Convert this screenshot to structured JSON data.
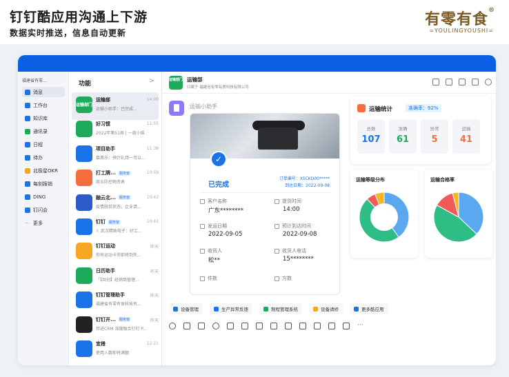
{
  "header": {
    "title": "钉钉酷应用沟通上下游",
    "subtitle": "数据实时推送，信息自动更新"
  },
  "brand": {
    "cn": "有零有食",
    "reg": "®",
    "en": "=YOULINGYOUSHI="
  },
  "sidebar": {
    "org": "福建省有零...",
    "items": [
      {
        "label": "消息"
      },
      {
        "label": "工作台"
      },
      {
        "label": "知识库"
      },
      {
        "label": "通讯录"
      },
      {
        "label": "日程"
      },
      {
        "label": "待办"
      },
      {
        "label": "北极星OKR"
      },
      {
        "label": "每刻报销"
      },
      {
        "label": "DING"
      },
      {
        "label": "钉闪会"
      },
      {
        "label": "更多"
      }
    ]
  },
  "list": {
    "title": "功能",
    "chevron": ">",
    "items": [
      {
        "name": "运输部",
        "preview": "运输小助手：已完成...",
        "time": "14:00",
        "avatar": "运输部门",
        "color": "#1eaa5b",
        "tag": ""
      },
      {
        "name": "好习惯",
        "preview": "2022年第51周 | 一周小结",
        "time": "11:55",
        "avatar": "",
        "color": "#1eaa5b",
        "tag": ""
      },
      {
        "name": "项目助手",
        "preview": "慕燕乐：预计礼拜一可以...",
        "time": "11:38",
        "avatar": "",
        "color": "#1a73e8",
        "tag": ""
      },
      {
        "name": "打工牌...",
        "preview": "周五防控物资表",
        "time": "10:59",
        "avatar": "",
        "color": "#f56c3d",
        "tag": "服务窗"
      },
      {
        "name": "融云北...",
        "preview": "疫情脱贫状态，企业请...",
        "time": "10:43",
        "avatar": "",
        "color": "#2b5bc8",
        "tag": "服务窗"
      },
      {
        "name": "钉钉",
        "preview": "✌ 武汉精致电子：好工...",
        "time": "10:43",
        "avatar": "",
        "color": "#1a73e8",
        "tag": "服务窗"
      },
      {
        "name": "钉钉运动",
        "preview": "你有运动卡市即将到失...",
        "time": "昨天",
        "avatar": "",
        "color": "#f5a623",
        "tag": ""
      },
      {
        "name": "日历助手",
        "preview": "「【共创】经销商管理...",
        "time": "昨天",
        "avatar": "",
        "color": "#1eaa5b",
        "tag": ""
      },
      {
        "name": "钉钉管理助手",
        "preview": "福建省有零有食科技有...",
        "time": "昨天",
        "avatar": "",
        "color": "#1a73e8",
        "tag": ""
      },
      {
        "name": "钉钉开...",
        "preview": "邦迹CRM 深度融合钉钉 P...",
        "time": "昨天",
        "avatar": "",
        "color": "#222",
        "tag": "服务窗"
      },
      {
        "name": "宜搭",
        "preview": "使用人数即将满额",
        "time": "12-21",
        "avatar": "",
        "color": "#1a73e8",
        "tag": ""
      }
    ]
  },
  "chat": {
    "name": "运输部",
    "org": "归属于 福建省有零有食科技有限公司",
    "avatar": "运输部门",
    "bot": "运输小助手"
  },
  "card": {
    "status": "已完成",
    "order_no": "订单编号：XSCKD00*****",
    "arrival": "到达日期：2022-09-08",
    "fields": [
      {
        "label": "客户名称",
        "value": "广东********"
      },
      {
        "label": "提货时间",
        "value": "14:00"
      },
      {
        "label": "发运日期",
        "value": "2022-09-05"
      },
      {
        "label": "预计到达时间",
        "value": "2022-09-08"
      },
      {
        "label": "收货人",
        "value": "松**"
      },
      {
        "label": "收货人电话",
        "value": "15********"
      },
      {
        "label": "件数",
        "value": ""
      },
      {
        "label": "方数",
        "value": ""
      }
    ]
  },
  "stats": {
    "title": "运输统计",
    "rate": "准确率：92%",
    "boxes": [
      {
        "label": "总数",
        "value": "107",
        "color": "#1a73e8"
      },
      {
        "label": "准确",
        "value": "61",
        "color": "#1eaa5b"
      },
      {
        "label": "异常",
        "value": "5",
        "color": "#f56c3d"
      },
      {
        "label": "运输",
        "value": "41",
        "color": "#f56c3d"
      }
    ]
  },
  "charts": [
    {
      "title": "运输等级分布",
      "type": "donut",
      "segments": [
        {
          "value": 0.4,
          "color": "#5aa9f0"
        },
        {
          "value": 0.48,
          "color": "#2ebd85"
        },
        {
          "value": 0.06,
          "color": "#f25a5a"
        },
        {
          "value": 0.06,
          "color": "#f5b623"
        }
      ]
    },
    {
      "title": "运输合格率",
      "type": "pie",
      "segments": [
        {
          "value": 0.37,
          "color": "#5aa9f0"
        },
        {
          "value": 0.46,
          "color": "#2ebd85"
        },
        {
          "value": 0.13,
          "color": "#f25a5a"
        },
        {
          "value": 0.04,
          "color": "#f5b623"
        }
      ]
    }
  ],
  "shortcuts": [
    {
      "label": "设备管理",
      "color": "#1a73e8"
    },
    {
      "label": "生产异常反馈",
      "color": "#1a73e8"
    },
    {
      "label": "制程管理系统",
      "color": "#1eaa5b"
    },
    {
      "label": "设备请修",
      "color": "#f5a623"
    },
    {
      "label": "更多酷应用",
      "color": "#1a73e8"
    }
  ]
}
